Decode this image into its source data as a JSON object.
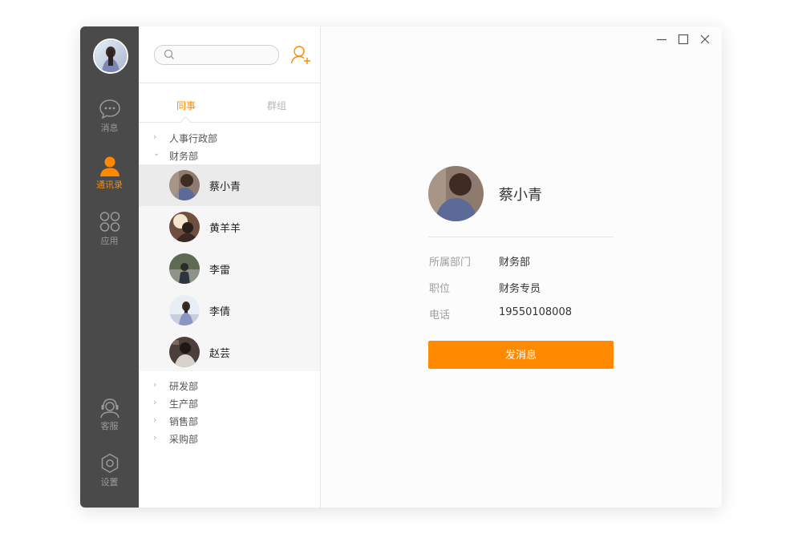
{
  "app": {
    "accent_color": "#ff8a00",
    "rail_color": "#4a4a4a"
  },
  "rail": {
    "avatar_icon": "user-avatar",
    "items": [
      {
        "label": "消息",
        "icon": "message-icon",
        "active": false
      },
      {
        "label": "通讯录",
        "icon": "contacts-icon",
        "active": true
      },
      {
        "label": "应用",
        "icon": "apps-icon",
        "active": false
      },
      {
        "label": "客服",
        "icon": "customer-service-icon",
        "active": false
      },
      {
        "label": "设置",
        "icon": "settings-icon",
        "active": false
      }
    ]
  },
  "search": {
    "placeholder": "",
    "value": ""
  },
  "tabs": [
    {
      "label": "同事",
      "active": true
    },
    {
      "label": "群组",
      "active": false
    }
  ],
  "departments_before": [
    {
      "name": "人事行政部",
      "expanded": false
    },
    {
      "name": "财务部",
      "expanded": true
    }
  ],
  "members": [
    {
      "name": "蔡小青",
      "selected": true
    },
    {
      "name": "黄羊羊",
      "selected": false
    },
    {
      "name": "李雷",
      "selected": false
    },
    {
      "name": "李倩",
      "selected": false
    },
    {
      "name": "赵芸",
      "selected": false
    }
  ],
  "departments_after": [
    {
      "name": "研发部",
      "expanded": false
    },
    {
      "name": "生产部",
      "expanded": false
    },
    {
      "name": "销售部",
      "expanded": false
    },
    {
      "name": "采购部",
      "expanded": false
    }
  ],
  "detail": {
    "name": "蔡小青",
    "fields": [
      {
        "label": "所属部门",
        "value": "财务部"
      },
      {
        "label": "职位",
        "value": "财务专员"
      },
      {
        "label": "电话",
        "value": "19550108008"
      }
    ],
    "send_label": "发消息"
  }
}
